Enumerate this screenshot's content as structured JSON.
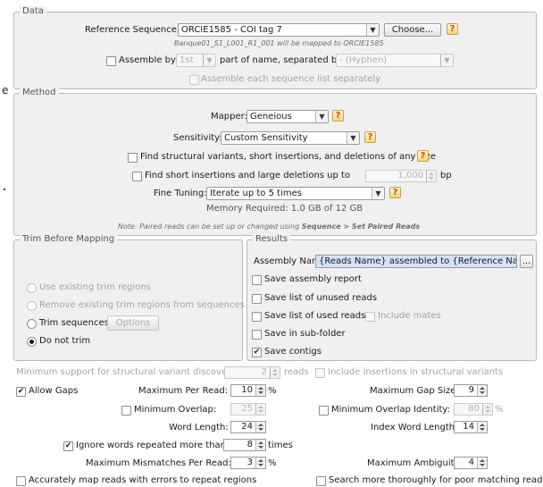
{
  "left_edge_fragment": "e",
  "data": {
    "legend": "Data",
    "reference_sequence_label": "Reference Sequence:",
    "reference_sequence_value": "ORCIE1585 - COI tag 7",
    "choose_button": "Choose...",
    "mapping_note": "Banque01_S1_L001_R1_001 will be mapped to ORCIE1585",
    "assemble_by_label": "Assemble by:",
    "assemble_by_value": "1st",
    "part_of_name_label": "part of name, separated by",
    "separator_value": "- (Hyphen)",
    "assemble_each_label": "Assemble each sequence list separately"
  },
  "method": {
    "legend": "Method",
    "mapper_label": "Mapper:",
    "mapper_value": "Geneious",
    "sensitivity_label": "Sensitivity:",
    "sensitivity_value": "Custom Sensitivity",
    "find_structural_label": "Find structural variants, short insertions, and deletions of any size",
    "find_short_label": "Find short insertions and large deletions up to",
    "find_short_value": "1,000",
    "find_short_unit": "bp",
    "fine_tuning_label": "Fine Tuning:",
    "fine_tuning_value": "Iterate up to 5 times",
    "memory_required": "Memory Required: 1.0 GB of 12 GB",
    "paired_note_prefix": "Note: Paired reads can be set up or changed using ",
    "paired_note_bold": "Sequence > Set Paired Reads"
  },
  "trim": {
    "legend": "Trim Before Mapping",
    "options": [
      {
        "label": "Use existing trim regions",
        "enabled": false,
        "selected": false
      },
      {
        "label": "Remove existing trim regions from sequences",
        "enabled": false,
        "selected": false
      },
      {
        "label": "Trim sequences",
        "enabled": true,
        "selected": false
      },
      {
        "label": "Do not trim",
        "enabled": true,
        "selected": true
      }
    ],
    "options_button": "Options"
  },
  "results": {
    "legend": "Results",
    "assembly_name_label": "Assembly Name",
    "assembly_name_value": "{Reads Name} assembled to {Reference Name}",
    "ellipsis_button": "...",
    "save_assembly_report": "Save assembly report",
    "save_unused": "Save list of unused reads",
    "save_used": "Save list of used reads",
    "include_mates": "Include mates",
    "save_subfolder": "Save in sub-folder",
    "save_contigs": "Save contigs"
  },
  "advanced": {
    "min_support_label": "Minimum support for structural variant discovery:",
    "min_support_value": "2",
    "reads_label": "reads",
    "include_insertions_label": "Include insertions in structural variants",
    "allow_gaps_label": "Allow Gaps",
    "max_per_read_label": "Maximum Per Read:",
    "max_per_read_value": "10",
    "percent": "%",
    "max_gap_size_label": "Maximum Gap Size:",
    "max_gap_size_value": "9",
    "min_overlap_label": "Minimum Overlap:",
    "min_overlap_value": "25",
    "min_overlap_identity_label": "Minimum Overlap Identity:",
    "min_overlap_identity_value": "80",
    "word_length_label": "Word Length:",
    "word_length_value": "24",
    "index_word_length_label": "Index Word Length:",
    "index_word_length_value": "14",
    "ignore_words_label": "Ignore words repeated more than",
    "ignore_words_value": "8",
    "times_label": "times",
    "max_mismatches_label": "Maximum Mismatches Per Read:",
    "max_mismatches_value": "3",
    "max_ambiguity_label": "Maximum Ambiguity:",
    "max_ambiguity_value": "4",
    "accurately_map_label": "Accurately map reads with errors to repeat regions",
    "search_thoroughly_label": "Search more thoroughly for poor matching reads"
  },
  "colors": {
    "panel_bg": "#f0f0f0",
    "selection_bg": "#d4e2f7",
    "help_accent": "#d24a00"
  }
}
